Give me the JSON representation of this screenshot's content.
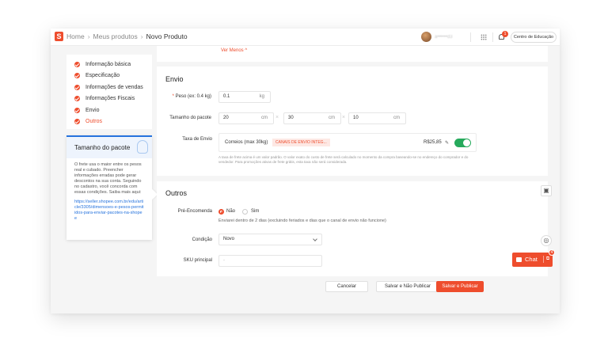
{
  "header": {
    "logo": "S",
    "breadcrumb": [
      "Home",
      "Meus produtos",
      "Novo Produto"
    ],
    "user_name": "a••••••d3",
    "notification_count": "1",
    "education_button": "Centro de Educação"
  },
  "sidebar": {
    "items": [
      {
        "label": "Informação básica"
      },
      {
        "label": "Especificação"
      },
      {
        "label": "Informações de vendas"
      },
      {
        "label": "Informações Fiscais"
      },
      {
        "label": "Envio"
      },
      {
        "label": "Outros"
      }
    ]
  },
  "tip": {
    "title": "Tamanho do pacote",
    "body": "O frete usa o maior entre os pesos real e cubado. Preencher informações erradas pode gerar descontos na sua conta. Seguindo no cadastro, você concorda com essas condições. Saiba mais aqui:",
    "link": "https://seller.shopee.com.br/edu/article/3305/dimensoes-e-pesos-permitidos-para-enviar-pacotes-na-shopee"
  },
  "top_card": {
    "ver_menos": "Ver Menos ^"
  },
  "envio": {
    "title": "Envio",
    "weight_label_req": "*",
    "weight_label": "Peso (ex: 0.4 kg)",
    "weight_value": "0.1",
    "weight_unit": "kg",
    "package_label": "Tamanho do pacote",
    "dims": [
      {
        "value": "20",
        "unit": "cm"
      },
      {
        "value": "30",
        "unit": "cm"
      },
      {
        "value": "10",
        "unit": "cm"
      }
    ],
    "times": "×",
    "fee_label": "Taxa de Envio",
    "carrier_name": "Correios  (max 30kg)",
    "carrier_tag": "CANAIS DE ENVIO INTEG...",
    "carrier_price": "R$25,85",
    "carrier_enabled": true,
    "note": "A taxa de frete acima é um valor padrão. O valor exato do custo de frete será calculado no momento da compra baseando-se no endereço do comprador e do vendedor. Para promoções ativas de frete grátis, esta taxa não será considerada."
  },
  "outros": {
    "title": "Outros",
    "preorder_label": "Pré-Encomenda",
    "preorder_options": [
      "Não",
      "Sim"
    ],
    "preorder_selected": "Não",
    "preorder_hint": "Enviarei dentro de 2 dias (excluindo feriados e dias que o canal de envio não funcione)",
    "condition_label": "Condição",
    "condition_value": "Novo",
    "sku_label": "SKU principal",
    "sku_placeholder": "-"
  },
  "footer": {
    "cancel": "Cancelar",
    "save_unpublished": "Salvar e Não Publicar",
    "save_publish": "Salvar e Publicar"
  },
  "chat": {
    "label": "Chat",
    "badge": "4"
  },
  "colors": {
    "accent": "#ee4d2d",
    "toggle_on": "#26aa5c",
    "tip_border": "#2673dd"
  }
}
